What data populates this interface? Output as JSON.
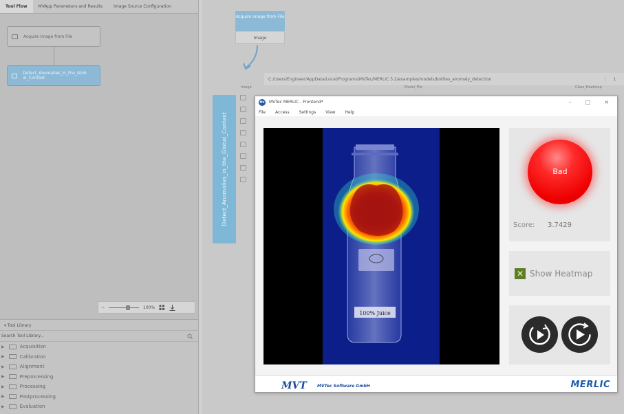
{
  "left_pane": {
    "tabs": [
      {
        "label": "Tool Flow"
      },
      {
        "label": "MVApp Parameters and Results"
      },
      {
        "label": "Image Source Configuration"
      }
    ],
    "flow_nodes": [
      {
        "label": "Acquire Image from File"
      },
      {
        "label": "Detect_Anomalies_in_the_Glob al_Context"
      }
    ],
    "zoom": {
      "minus": "−",
      "value": "100%"
    },
    "tool_library": {
      "title": "Tool Library",
      "search_placeholder": "Search Tool Library...",
      "categories": [
        {
          "label": "Acquisition"
        },
        {
          "label": "Calibration"
        },
        {
          "label": "Alignment"
        },
        {
          "label": "Preprocessing"
        },
        {
          "label": "Processing"
        },
        {
          "label": "Postprocessing"
        },
        {
          "label": "Evaluation"
        }
      ]
    }
  },
  "flow_area": {
    "source_node": {
      "title": "Acquire Image from File",
      "output": "Image"
    },
    "vertical_tool": {
      "label": "Detect_Anomalies_in_the_Global_Context"
    },
    "param_path": "C:/Users/Engineer/AppData/Local/Programs/MVTec/MERLIC 5.2/examples/models/bottles_anomaly_detection",
    "param_stepper": "1",
    "param_headers": {
      "image": "Image",
      "model_file": "Model_File",
      "class_heatmap": "Class_Heatmap"
    }
  },
  "frontend": {
    "title": "MVTec MERLIC - Frontend*",
    "logo_text": "MV",
    "window_controls": {
      "minimize": "–",
      "maximize": "□",
      "close": "×"
    },
    "menu": [
      {
        "label": "File"
      },
      {
        "label": "Access"
      },
      {
        "label": "Settings"
      },
      {
        "label": "View"
      },
      {
        "label": "Help"
      }
    ],
    "status": {
      "text": "Bad",
      "color": "#ff1a1a"
    },
    "score": {
      "label": "Score:",
      "value": "3.7429"
    },
    "heatmap": {
      "label": "Show Heatmap",
      "checked": true
    },
    "bottle_label": "100% Juice",
    "footer": {
      "company_logo": "MVT",
      "company_name": "MVTec Software GmbH",
      "product_logo": "MERLIC"
    }
  }
}
